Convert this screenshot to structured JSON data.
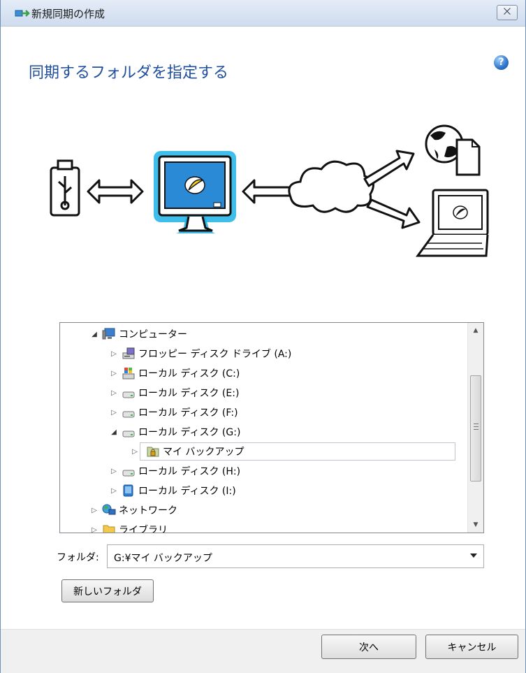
{
  "window": {
    "title": "新規同期の作成",
    "close_symbol": "⨉"
  },
  "heading": "同期するフォルダを指定する",
  "help_symbol": "?",
  "tree": {
    "items": [
      {
        "label": "コンピューター",
        "icon": "computer-icon",
        "expander": "open"
      },
      {
        "label": "フロッピー ディスク ドライブ (A:)",
        "icon": "floppy-drive-icon",
        "expander": "closed"
      },
      {
        "label": "ローカル ディスク (C:)",
        "icon": "system-drive-icon",
        "expander": "closed"
      },
      {
        "label": "ローカル ディスク (E:)",
        "icon": "drive-icon",
        "expander": "closed"
      },
      {
        "label": "ローカル ディスク (F:)",
        "icon": "drive-icon",
        "expander": "closed"
      },
      {
        "label": "ローカル ディスク (G:)",
        "icon": "drive-icon",
        "expander": "open"
      },
      {
        "label": "マイ バックアップ",
        "icon": "locked-folder-icon",
        "expander": "closed",
        "selected": true
      },
      {
        "label": "ローカル ディスク (H:)",
        "icon": "drive-icon",
        "expander": "closed"
      },
      {
        "label": "ローカル ディスク (I:)",
        "icon": "removable-drive-icon",
        "expander": "closed"
      },
      {
        "label": "ネットワーク",
        "icon": "network-icon",
        "expander": "closed"
      },
      {
        "label": "ライブラリ",
        "icon": "library-folder-icon",
        "expander": "closed"
      }
    ]
  },
  "folder": {
    "label": "フォルダ:",
    "value": "G:¥マイ バックアップ"
  },
  "buttons": {
    "new_folder": "新しいフォルダ",
    "next": "次へ",
    "cancel": "キャンセル"
  },
  "colors": {
    "heading": "#1f4e9c",
    "accent_glow": "#1fb3e8",
    "screen_blue": "#2a8ad6"
  }
}
